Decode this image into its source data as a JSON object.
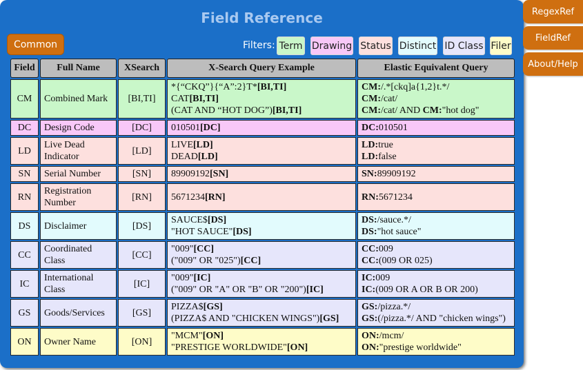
{
  "panel": {
    "title": "Field Reference",
    "common_label": "Common",
    "filters_label": "Filters:",
    "filters": [
      {
        "label": "Term",
        "color": "#c9f7c9"
      },
      {
        "label": "Drawing",
        "color": "#f8c8f8"
      },
      {
        "label": "Status",
        "color": "#fde0de"
      },
      {
        "label": "Distinct",
        "color": "#e2fbfd"
      },
      {
        "label": "ID Class",
        "color": "#e6e6fb"
      },
      {
        "label": "Filer",
        "color": "#fefcc8"
      }
    ]
  },
  "table": {
    "headers": [
      "Field",
      "Full Name",
      "XSearch",
      "X-Search Query Example",
      "Elastic Equivalent Query"
    ],
    "rows": [
      {
        "field": "CM",
        "name": "Combined Mark",
        "xsearch": "[BI,TI]",
        "color": "#c9f7c9",
        "example": [
          [
            "*{“CKQ”}{“A”:2}T*",
            "[BI,TI]"
          ],
          [
            "CAT",
            "[BI,TI]"
          ],
          [
            "(CAT AND “HOT DOG”)",
            "[BI,TI]"
          ]
        ],
        "elastic": [
          [
            "CM:",
            "/.*[ckq]a{1,2}t.*/"
          ],
          [
            "CM:",
            "/cat/"
          ],
          [
            "CM:",
            "/cat/ AND ",
            "CM:",
            "\"hot dog\""
          ]
        ]
      },
      {
        "field": "DC",
        "name": "Design Code",
        "xsearch": "[DC]",
        "color": "#f8c8f8",
        "example": [
          [
            "010501",
            "[DC]"
          ]
        ],
        "elastic": [
          [
            "DC:",
            "010501"
          ]
        ]
      },
      {
        "field": "LD",
        "name": "Live Dead Indicator",
        "xsearch": "[LD]",
        "color": "#fde0de",
        "example": [
          [
            "LIVE",
            "[LD]"
          ],
          [
            "DEAD",
            "[LD]"
          ]
        ],
        "elastic": [
          [
            "LD:",
            "true"
          ],
          [
            "LD:",
            "false"
          ]
        ]
      },
      {
        "field": "SN",
        "name": "Serial Number",
        "xsearch": "[SN]",
        "color": "#fde0de",
        "example": [
          [
            "89909192",
            "[SN]"
          ]
        ],
        "elastic": [
          [
            "SN:",
            "89909192"
          ]
        ]
      },
      {
        "field": "RN",
        "name": "Registration Number",
        "xsearch": "[RN]",
        "color": "#fde0de",
        "example": [
          [
            "5671234",
            "[RN]"
          ]
        ],
        "elastic": [
          [
            "RN:",
            "5671234"
          ]
        ]
      },
      {
        "field": "DS",
        "name": "Disclaimer",
        "xsearch": "[DS]",
        "color": "#e2fbfd",
        "example": [
          [
            "SAUCE$",
            "[DS]"
          ],
          [
            "\"HOT SAUCE\"",
            "[DS]"
          ]
        ],
        "elastic": [
          [
            "DS:",
            "/sauce.*/"
          ],
          [
            "DS:",
            "\"hot sauce\""
          ]
        ]
      },
      {
        "field": "CC",
        "name": "Coordinated Class",
        "xsearch": "[CC]",
        "color": "#e6e6fb",
        "example": [
          [
            "\"009\"",
            "[CC]"
          ],
          [
            "(\"009\" OR \"025\")",
            "[CC]"
          ]
        ],
        "elastic": [
          [
            "CC:",
            "009"
          ],
          [
            "CC:",
            "(009 OR 025)"
          ]
        ]
      },
      {
        "field": "IC",
        "name": "International Class",
        "xsearch": "[IC]",
        "color": "#e6e6fb",
        "example": [
          [
            "\"009\"",
            "[IC]"
          ],
          [
            "(\"009\" OR \"A\" OR \"B\" OR \"200\")",
            "[IC]"
          ]
        ],
        "elastic": [
          [
            "IC:",
            "009"
          ],
          [
            "IC:",
            "(009 OR A OR B OR 200)"
          ]
        ]
      },
      {
        "field": "GS",
        "name": "Goods/Services",
        "xsearch": "[GS]",
        "color": "#e6e6fb",
        "example": [
          [
            "PIZZA$",
            "[GS]"
          ],
          [
            "(PIZZA$ AND \"CHICKEN WINGS\")",
            "[GS]"
          ]
        ],
        "elastic": [
          [
            "GS:",
            "/pizza.*/"
          ],
          [
            "GS:",
            "(/pizza.*/ AND \"chicken wings\")"
          ]
        ]
      },
      {
        "field": "ON",
        "name": "Owner Name",
        "xsearch": "[ON]",
        "color": "#fefcc8",
        "example": [
          [
            "\"MCM\"",
            "[ON]"
          ],
          [
            "\"PRESTIGE WORLDWIDE\"",
            "[ON]"
          ]
        ],
        "elastic": [
          [
            "ON:",
            "/mcm/"
          ],
          [
            "ON:",
            "\"prestige worldwide\""
          ]
        ]
      }
    ]
  },
  "side_nav": {
    "items": [
      "RegexRef",
      "FieldRef",
      "About/Help"
    ],
    "accent": "#cf6f10"
  }
}
